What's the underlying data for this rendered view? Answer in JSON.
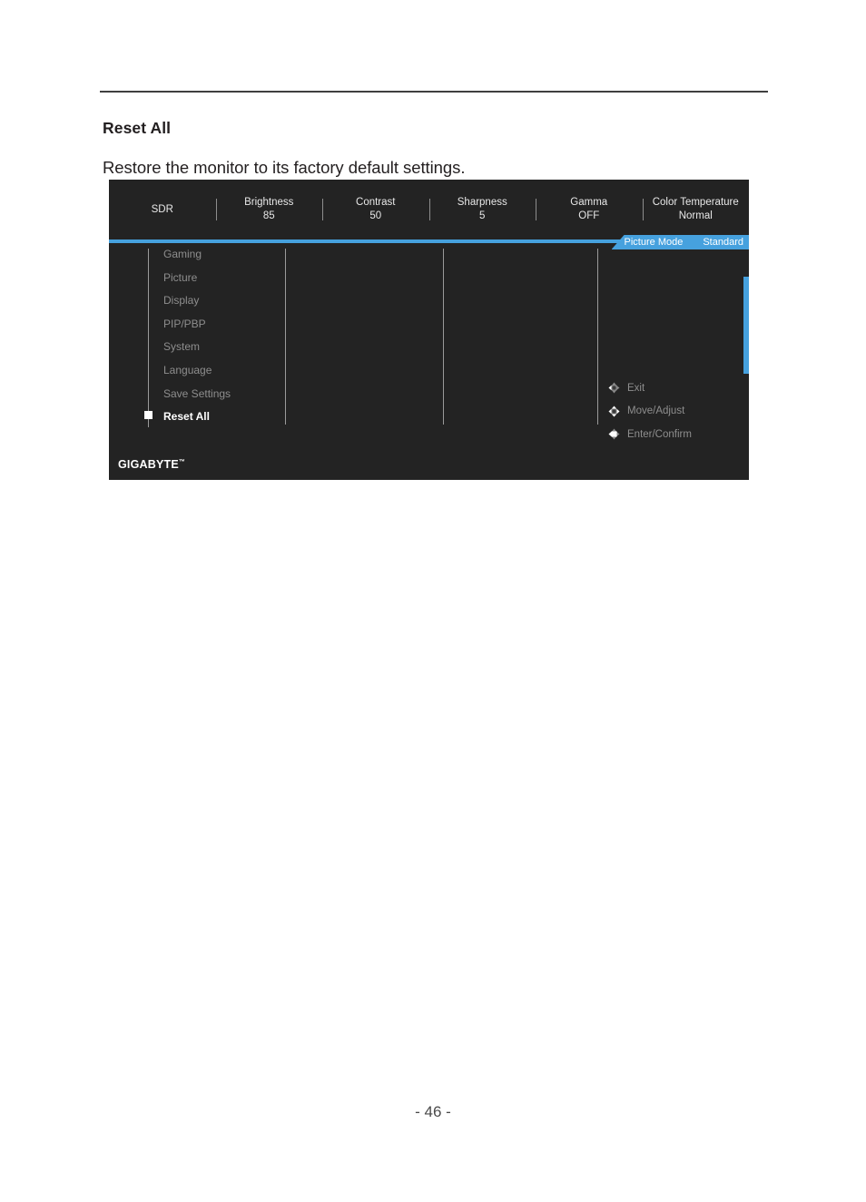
{
  "page": {
    "heading": "Reset All",
    "description": "Restore the monitor to its factory default settings.",
    "page_number": "- 46 -"
  },
  "osd": {
    "accent_color": "#46a1de",
    "background_color": "#232323",
    "header_items": [
      {
        "label": "SDR",
        "value": ""
      },
      {
        "label": "Brightness",
        "value": "85"
      },
      {
        "label": "Contrast",
        "value": "50"
      },
      {
        "label": "Sharpness",
        "value": "5"
      },
      {
        "label": "Gamma",
        "value": "OFF"
      },
      {
        "label": "Color Temperature",
        "value": "Normal"
      }
    ],
    "picture_mode": {
      "label": "Picture Mode",
      "value": "Standard"
    },
    "menu_items": [
      {
        "label": "Gaming",
        "selected": false
      },
      {
        "label": "Picture",
        "selected": false
      },
      {
        "label": "Display",
        "selected": false
      },
      {
        "label": "PIP/PBP",
        "selected": false
      },
      {
        "label": "System",
        "selected": false
      },
      {
        "label": "Language",
        "selected": false
      },
      {
        "label": "Save Settings",
        "selected": false
      },
      {
        "label": "Reset All",
        "selected": true
      }
    ],
    "hints": [
      {
        "label": "Exit",
        "icon": "joystick-left-icon"
      },
      {
        "label": "Move/Adjust",
        "icon": "joystick-move-icon"
      },
      {
        "label": "Enter/Confirm",
        "icon": "joystick-press-icon"
      }
    ],
    "logo": {
      "text": "GIGABYTE",
      "trademark": "™"
    }
  }
}
